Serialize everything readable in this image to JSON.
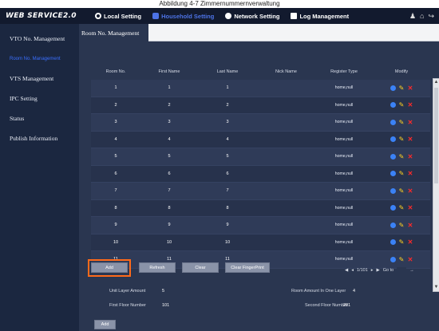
{
  "caption": "Abbildung 4-7 Zimmernummernverwaltung",
  "header": {
    "logo": "WEB SERVICE2.0",
    "menu": [
      {
        "label": "Local Setting",
        "icon": "gear-icon",
        "active": false
      },
      {
        "label": "Household Setting",
        "icon": "household-icon",
        "active": true
      },
      {
        "label": "Network Setting",
        "icon": "globe-icon",
        "active": false
      },
      {
        "label": "Log Management",
        "icon": "log-icon",
        "active": false
      }
    ],
    "right_icons": [
      "user-icon",
      "home-icon",
      "logout-icon"
    ]
  },
  "sidebar": {
    "items": [
      {
        "label": "VTO No. Management"
      },
      {
        "label": "Room No. Management"
      },
      {
        "label": "VTS Management"
      },
      {
        "label": "IPC Setting"
      },
      {
        "label": "Status"
      },
      {
        "label": "Publish Information"
      }
    ]
  },
  "tab": {
    "label": "Room No. Management"
  },
  "table": {
    "columns": [
      "Room No.",
      "First Name",
      "Last Name",
      "Nick Name",
      "Register Type",
      "Modify"
    ],
    "rows": [
      {
        "room": "1",
        "first": "1",
        "last": "1",
        "nick": "",
        "type": "home,null"
      },
      {
        "room": "2",
        "first": "2",
        "last": "2",
        "nick": "",
        "type": "home,null"
      },
      {
        "room": "3",
        "first": "3",
        "last": "3",
        "nick": "",
        "type": "home,null"
      },
      {
        "room": "4",
        "first": "4",
        "last": "4",
        "nick": "",
        "type": "home,null"
      },
      {
        "room": "5",
        "first": "5",
        "last": "5",
        "nick": "",
        "type": "home,null"
      },
      {
        "room": "6",
        "first": "6",
        "last": "6",
        "nick": "",
        "type": "home,null"
      },
      {
        "room": "7",
        "first": "7",
        "last": "7",
        "nick": "",
        "type": "home,null"
      },
      {
        "room": "8",
        "first": "8",
        "last": "8",
        "nick": "",
        "type": "home,null"
      },
      {
        "room": "9",
        "first": "9",
        "last": "9",
        "nick": "",
        "type": "home,null"
      },
      {
        "room": "10",
        "first": "10",
        "last": "10",
        "nick": "",
        "type": "home,null"
      },
      {
        "room": "11",
        "first": "11",
        "last": "11",
        "nick": "",
        "type": "home,null"
      }
    ]
  },
  "buttons": {
    "add": "Add",
    "refresh": "Refresh",
    "clear": "Clear",
    "clear_fingerprint": "Clear FingerPrint",
    "add_bottom": "Add"
  },
  "pager": {
    "page_text": "1/101",
    "goto_label": "Go to"
  },
  "form": {
    "unit_layer_amount_label": "Unit Layer Amount",
    "unit_layer_amount_value": "5",
    "room_amount_label": "Room Amount In One Layer",
    "room_amount_value": "4",
    "first_floor_label": "First Floor Number",
    "first_floor_value": "101",
    "second_floor_label": "Second Floor Number",
    "second_floor_value": "201"
  },
  "colors": {
    "topbar": "#121a2e",
    "sidebar": "#1b2740",
    "content": "#2a3650",
    "active_menu": "#4d73e6",
    "highlight": "#ff6a1a"
  }
}
